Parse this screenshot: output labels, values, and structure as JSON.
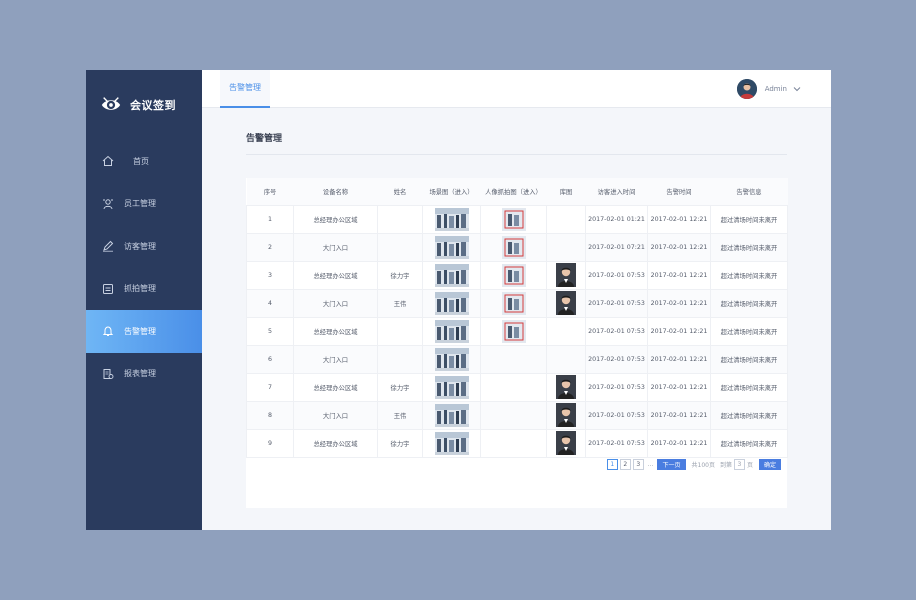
{
  "brand": {
    "name": "会议签到"
  },
  "sidebar": {
    "items": [
      {
        "label": "首页",
        "icon": "home-icon"
      },
      {
        "label": "员工管理",
        "icon": "staff-icon"
      },
      {
        "label": "访客管理",
        "icon": "edit-icon"
      },
      {
        "label": "抓拍管理",
        "icon": "capture-icon"
      },
      {
        "label": "告警管理",
        "icon": "bell-icon",
        "active": true
      },
      {
        "label": "报表管理",
        "icon": "report-icon"
      }
    ]
  },
  "header": {
    "tab": "告警管理",
    "user": "Admin"
  },
  "page": {
    "title": "告警管理"
  },
  "table": {
    "columns": [
      "序号",
      "设备名称",
      "姓名",
      "场景图（进入）",
      "人像抓拍图（进入）",
      "库图",
      "访客进入时间",
      "告警时间",
      "告警信息"
    ],
    "rows": [
      {
        "no": "1",
        "device": "总经理办公区域",
        "name": "",
        "scene": true,
        "snap": true,
        "lib": false,
        "enter": "2017-02-01 01:21",
        "alarm": "2017-02-01 12:21",
        "info": "超过清场时间未离开"
      },
      {
        "no": "2",
        "device": "大门入口",
        "name": "",
        "scene": true,
        "snap": true,
        "lib": false,
        "enter": "2017-02-01 07:21",
        "alarm": "2017-02-01 12:21",
        "info": "超过清场时间未离开"
      },
      {
        "no": "3",
        "device": "总经理办公区域",
        "name": "徐力宇",
        "scene": true,
        "snap": true,
        "lib": true,
        "enter": "2017-02-01 07:53",
        "alarm": "2017-02-01 12:21",
        "info": "超过清场时间未离开"
      },
      {
        "no": "4",
        "device": "大门入口",
        "name": "王伟",
        "scene": true,
        "snap": true,
        "lib": true,
        "enter": "2017-02-01 07:53",
        "alarm": "2017-02-01 12:21",
        "info": "超过清场时间未离开"
      },
      {
        "no": "5",
        "device": "总经理办公区域",
        "name": "",
        "scene": true,
        "snap": true,
        "lib": false,
        "enter": "2017-02-01 07:53",
        "alarm": "2017-02-01 12:21",
        "info": "超过清场时间未离开"
      },
      {
        "no": "6",
        "device": "大门入口",
        "name": "",
        "scene": true,
        "snap": false,
        "lib": false,
        "enter": "2017-02-01 07:53",
        "alarm": "2017-02-01 12:21",
        "info": "超过清场时间未离开"
      },
      {
        "no": "7",
        "device": "总经理办公区域",
        "name": "徐力宇",
        "scene": true,
        "snap": false,
        "lib": true,
        "enter": "2017-02-01 07:53",
        "alarm": "2017-02-01 12:21",
        "info": "超过清场时间未离开"
      },
      {
        "no": "8",
        "device": "大门入口",
        "name": "王伟",
        "scene": true,
        "snap": false,
        "lib": true,
        "enter": "2017-02-01 07:53",
        "alarm": "2017-02-01 12:21",
        "info": "超过清场时间未离开"
      },
      {
        "no": "9",
        "device": "总经理办公区域",
        "name": "徐力宇",
        "scene": true,
        "snap": false,
        "lib": true,
        "enter": "2017-02-01 07:53",
        "alarm": "2017-02-01 12:21",
        "info": "超过清场时间未离开"
      }
    ]
  },
  "pagination": {
    "pages": [
      "1",
      "2",
      "3"
    ],
    "current": "1",
    "dots": "...",
    "next": "下一页",
    "total": "共100页",
    "goto_prefix": "到第",
    "goto_value": "3",
    "goto_suffix": "页",
    "confirm": "确定"
  },
  "colors": {
    "sidebar": "#2a3b5e",
    "accent": "#4a8fe8",
    "active_gradient_start": "#6fb6f5"
  }
}
